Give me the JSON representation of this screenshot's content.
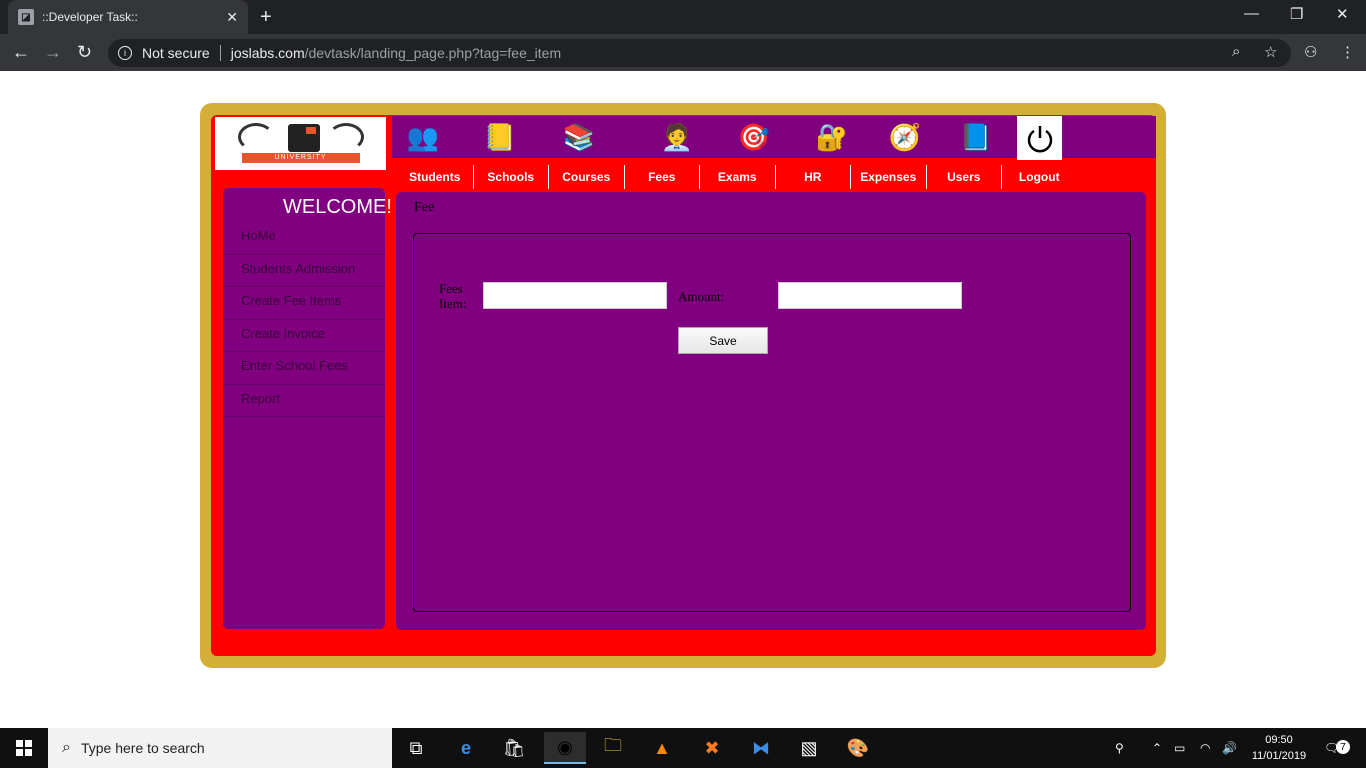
{
  "browser": {
    "tab_title": "::Developer Task::",
    "security_label": "Not secure",
    "url_host": "joslabs.com",
    "url_path": "/devtask/landing_page.php?tag=fee_item"
  },
  "header": {
    "logo_ribbon_text": "UNIVERSITY",
    "icons": [
      "students-icon",
      "schools-icon",
      "courses-icon",
      "fees-icon",
      "exams-icon",
      "hr-icon",
      "expenses-icon",
      "users-icon",
      "power-icon"
    ],
    "menu": [
      "Students",
      "Schools",
      "Courses",
      "Fees",
      "Exams",
      "HR",
      "Expenses",
      "Users",
      "Logout"
    ]
  },
  "sidebar": {
    "welcome": "WELCOME!",
    "items": [
      "HoMe",
      "Students Admission",
      "Create Fee Items",
      "Create Invoice",
      "Enter School Fees",
      "Report"
    ]
  },
  "main": {
    "breadcrumb": "Fee",
    "form": {
      "fees_item_label": "Fees Item:",
      "fees_item_value": "",
      "amount_label": "Amount:",
      "amount_value": "",
      "save_label": "Save"
    }
  },
  "taskbar": {
    "search_placeholder": "Type here to search",
    "time": "09:50",
    "date": "11/01/2019",
    "notification_count": "7"
  },
  "colors": {
    "frame_gold": "#d4af37",
    "frame_red": "#ff0000",
    "panel_purple": "#800080"
  }
}
